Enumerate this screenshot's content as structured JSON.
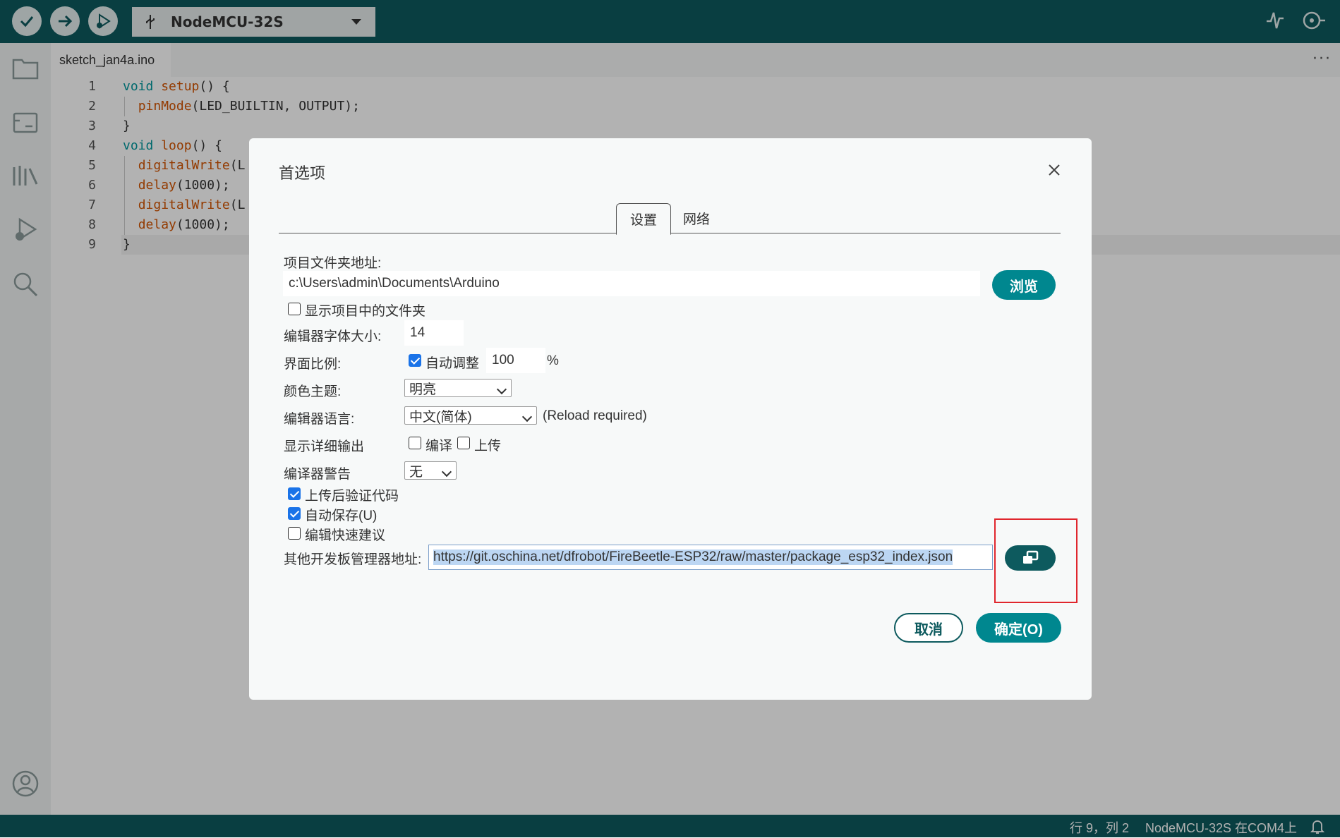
{
  "toolbar": {
    "board_name": "NodeMCU-32S",
    "verify_icon": "check-icon",
    "upload_icon": "arrow-right-icon",
    "debug_icon": "debug-icon"
  },
  "editor": {
    "file_tab": "sketch_jan4a.ino",
    "lines": [
      {
        "n": "1",
        "text": "void setup() {"
      },
      {
        "n": "2",
        "text": "  pinMode(LED_BUILTIN, OUTPUT);"
      },
      {
        "n": "3",
        "text": "}"
      },
      {
        "n": "4",
        "text": "void loop() {"
      },
      {
        "n": "5",
        "text": "  digitalWrite(L"
      },
      {
        "n": "6",
        "text": "  delay(1000);"
      },
      {
        "n": "7",
        "text": "  digitalWrite(L"
      },
      {
        "n": "8",
        "text": "  delay(1000);"
      },
      {
        "n": "9",
        "text": "}"
      }
    ]
  },
  "status": {
    "position": "行 9，列 2",
    "board_port": "NodeMCU-32S 在COM4上"
  },
  "dialog": {
    "title": "首选项",
    "tabs": [
      "设置",
      "网络"
    ],
    "sketchbook_label": "项目文件夹地址:",
    "sketchbook_path": "c:\\Users\\admin\\Documents\\Arduino",
    "browse_button": "浏览",
    "show_files_label": "显示项目中的文件夹",
    "font_size_label": "编辑器字体大小:",
    "font_size_value": "14",
    "scale_label": "界面比例:",
    "auto_scale_label": "自动调整",
    "scale_value": "100",
    "scale_unit": "%",
    "theme_label": "颜色主题:",
    "theme_value": "明亮",
    "language_label": "编辑器语言:",
    "language_value": "中文(简体)",
    "reload_note": "(Reload required)",
    "verbose_label": "显示详细输出",
    "verbose_compile": "编译",
    "verbose_upload": "上传",
    "warnings_label": "编译器警告",
    "warnings_value": "无",
    "verify_after_upload": "上传后验证代码",
    "auto_save": "自动保存(U)",
    "quick_suggestions": "编辑快速建议",
    "board_urls_label": "其他开发板管理器地址:",
    "board_urls_value": "https://git.oschina.net/dfrobot/FireBeetle-ESP32/raw/master/package_esp32_index.json",
    "cancel_button": "取消",
    "ok_button": "确定(O)"
  }
}
